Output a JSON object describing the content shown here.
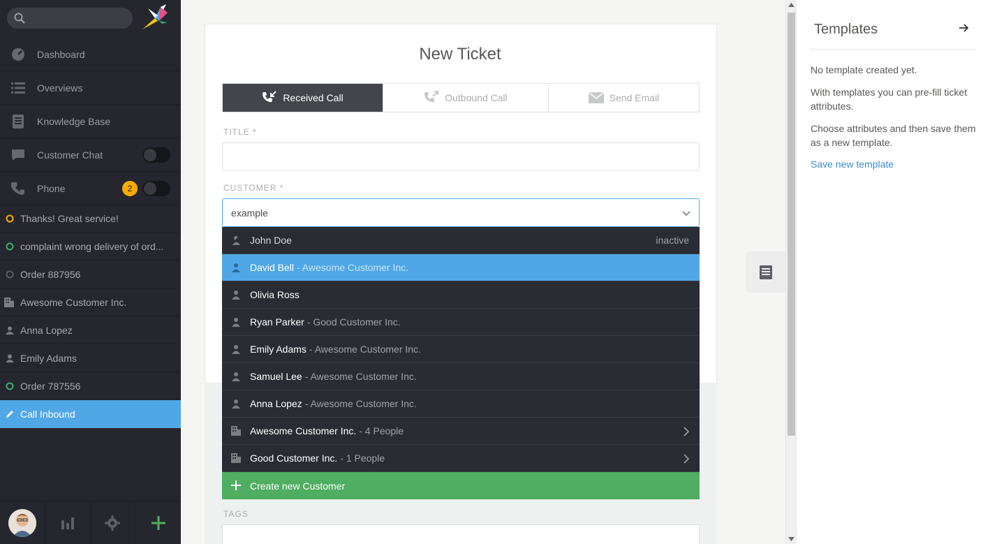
{
  "sidebar": {
    "search": {
      "placeholder": "",
      "value": ""
    },
    "nav": [
      {
        "label": "Dashboard",
        "icon": "dashboard-icon"
      },
      {
        "label": "Overviews",
        "icon": "list-icon"
      },
      {
        "label": "Knowledge Base",
        "icon": "book-icon"
      },
      {
        "label": "Customer Chat",
        "icon": "chat-icon",
        "toggle": "off"
      },
      {
        "label": "Phone",
        "icon": "phone-icon",
        "badge": "2",
        "toggle": "off"
      }
    ],
    "tasks": [
      {
        "label": "Thanks! Great service!",
        "icon": "ticket-status-pending-icon",
        "color": "#faab00"
      },
      {
        "label": "complaint wrong delivery of ord...",
        "icon": "ticket-status-open-icon",
        "color": "#38ad69"
      },
      {
        "label": "Order 887956",
        "icon": "ticket-status-closed-icon",
        "color": "#5a5c60"
      },
      {
        "label": "Awesome Customer Inc.",
        "icon": "organization-icon"
      },
      {
        "label": "Anna Lopez",
        "icon": "user-icon"
      },
      {
        "label": "Emily Adams",
        "icon": "user-icon"
      },
      {
        "label": "Order 787556",
        "icon": "ticket-status-open-icon",
        "color": "#38ad69"
      },
      {
        "label": "Call Inbound",
        "icon": "pencil-icon",
        "active": true
      }
    ]
  },
  "main": {
    "title": "New Ticket",
    "tabs": [
      {
        "label": "Received Call",
        "icon": "received-call-icon",
        "active": true
      },
      {
        "label": "Outbound Call",
        "icon": "outbound-call-icon"
      },
      {
        "label": "Send Email",
        "icon": "email-icon"
      }
    ],
    "title_label": "TITLE *",
    "title_value": "",
    "customer_label": "CUSTOMER *",
    "customer_value": "example",
    "tags_label": "TAGS",
    "dropdown": [
      {
        "name": "John Doe",
        "sub": "",
        "right": "inactive",
        "icon": "inactive-user-icon"
      },
      {
        "name": "David Bell",
        "sub": "- Awesome Customer Inc.",
        "icon": "user-icon",
        "selected": true
      },
      {
        "name": "Olivia Ross",
        "sub": "",
        "icon": "user-icon"
      },
      {
        "name": "Ryan Parker",
        "sub": "- Good Customer Inc.",
        "icon": "user-icon"
      },
      {
        "name": "Emily Adams",
        "sub": "- Awesome Customer Inc.",
        "icon": "user-icon"
      },
      {
        "name": "Samuel Lee",
        "sub": "- Awesome Customer Inc.",
        "icon": "user-icon"
      },
      {
        "name": "Anna Lopez",
        "sub": "- Awesome Customer Inc.",
        "icon": "user-icon"
      },
      {
        "name": "Awesome Customer Inc.",
        "sub": "- 4 People",
        "icon": "organization-icon",
        "arrow": true
      },
      {
        "name": "Good Customer Inc.",
        "sub": "- 1 People",
        "icon": "organization-icon",
        "arrow": true
      }
    ],
    "create_label": "Create new Customer"
  },
  "templates": {
    "title": "Templates",
    "none": "No template created yet.",
    "help1": "With templates you can pre-fill ticket attributes.",
    "help2": "Choose attributes and then save them as a new template.",
    "save_link": "Save new template"
  },
  "colors": {
    "accent": "#50a7e6",
    "success": "#4fae62",
    "warning": "#faab00",
    "sidebar": "#26272e"
  }
}
